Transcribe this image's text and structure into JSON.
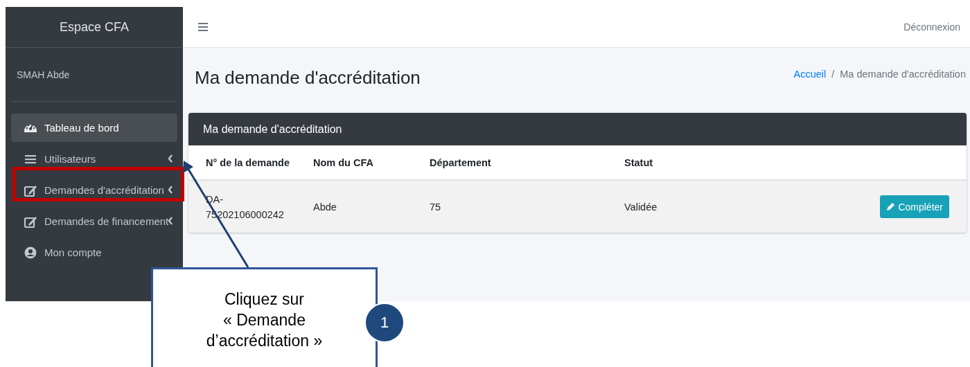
{
  "sidebar": {
    "brand": "Espace CFA",
    "user": "SMAH Abde",
    "items": [
      {
        "label": "Tableau de bord",
        "kind": "dashboard",
        "selected": true,
        "submenu": false
      },
      {
        "label": "Utilisateurs",
        "kind": "list",
        "selected": false,
        "submenu": true
      },
      {
        "label": "Demandes d'accréditation",
        "kind": "edit",
        "selected": false,
        "submenu": true
      },
      {
        "label": "Demandes de financement",
        "kind": "edit",
        "selected": false,
        "submenu": true
      },
      {
        "label": "Mon compte",
        "kind": "account",
        "selected": false,
        "submenu": false
      }
    ]
  },
  "topbar": {
    "logout": "Déconnexion"
  },
  "page": {
    "title": "Ma demande d'accréditation",
    "breadcrumb": [
      {
        "label": "Accueil",
        "link": true
      },
      {
        "label": "Ma demande d'accréditation",
        "link": false
      }
    ],
    "separator": "/"
  },
  "card": {
    "title": "Ma demande d'accréditation",
    "columns": [
      "N° de la demande",
      "Nom du CFA",
      "Département",
      "Statut"
    ],
    "rows": [
      {
        "cells": [
          "DA-75202106000242",
          "Abde",
          "75",
          "Validée"
        ],
        "action": "Compléter"
      }
    ]
  },
  "callout": {
    "text": "Cliquez sur\n« Demande\nd’accréditation »",
    "step": "1"
  }
}
